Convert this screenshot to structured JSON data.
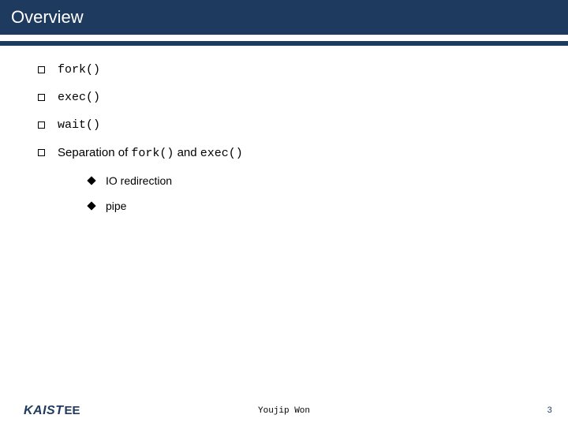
{
  "title": "Overview",
  "bullets": {
    "b0": "fork()",
    "b1": "exec()",
    "b2": "wait()",
    "b3": {
      "part1": "Separation of ",
      "code1": "fork()",
      "part2": " and ",
      "code2": "exec()"
    }
  },
  "sub": {
    "s0": "IO redirection",
    "s1": "pipe"
  },
  "footer": {
    "logo_main": "KAIST",
    "logo_suffix": "EE",
    "author": "Youjip Won",
    "page": "3"
  },
  "colors": {
    "accent": "#1f3a5f"
  }
}
